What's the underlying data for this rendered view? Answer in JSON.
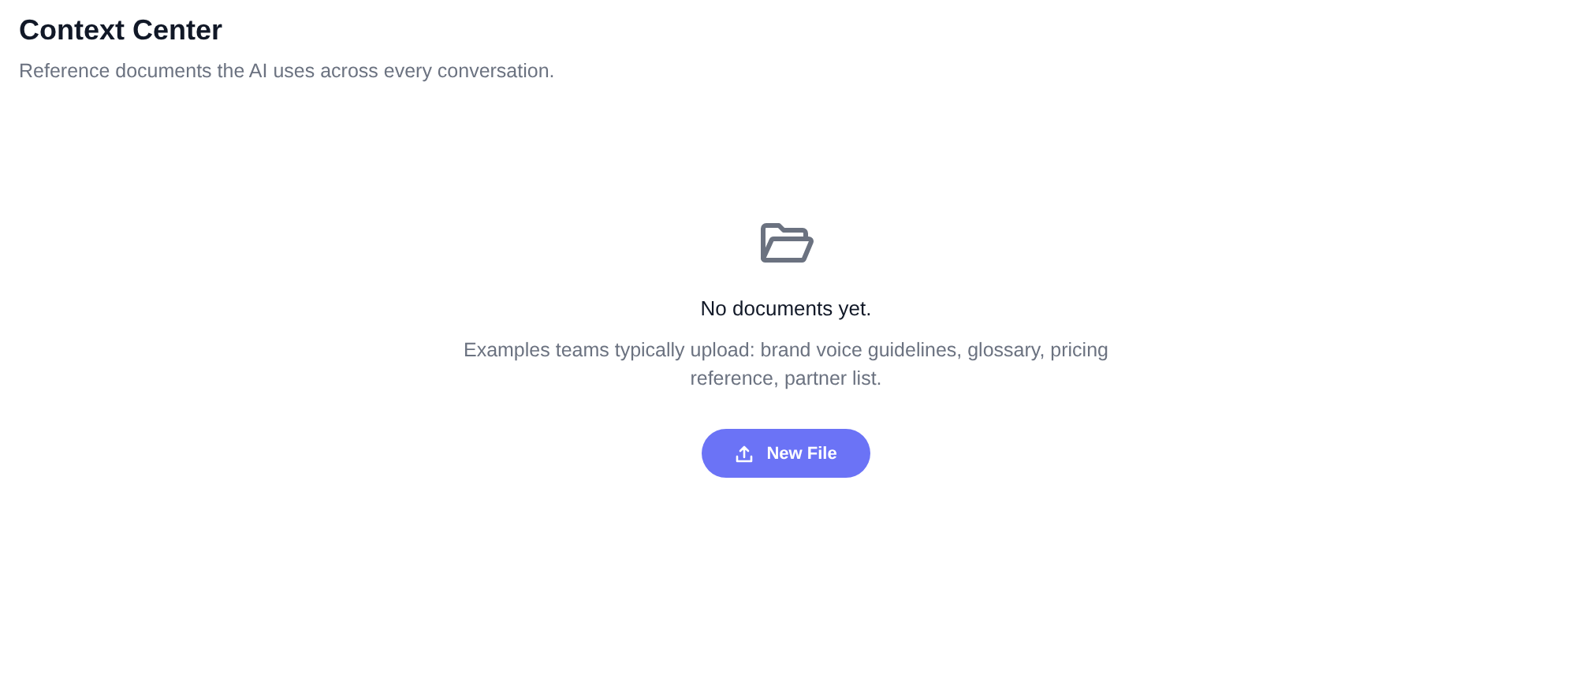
{
  "header": {
    "title": "Context Center",
    "subtitle": "Reference documents the AI uses across every conversation."
  },
  "empty_state": {
    "heading": "No documents yet.",
    "description": "Examples teams typically upload: brand voice guidelines, glossary, pricing reference, partner list.",
    "button": "New File"
  }
}
